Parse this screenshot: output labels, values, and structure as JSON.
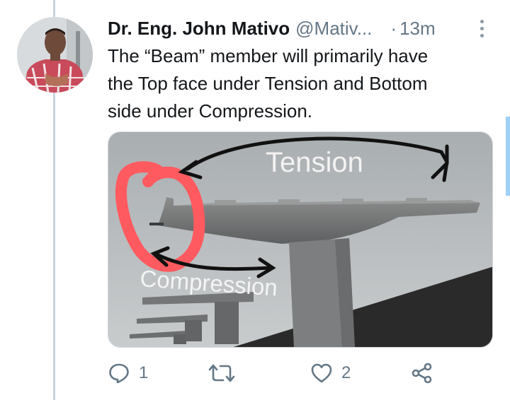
{
  "tweet": {
    "author_name": "Dr. Eng. John Mativo",
    "author_handle": "@Mativ...",
    "separator": "·",
    "timestamp": "13m",
    "text_lines": [
      "The “Beam” member will primarily have",
      "the Top face under Tension and Bottom",
      "side under Compression."
    ]
  },
  "media": {
    "label_tension": "Tension",
    "label_compression": "Compression",
    "annotation_color": "#ff5a5f",
    "arrow_color": "#111111"
  },
  "actions": {
    "reply_count": "1",
    "retweet_count": "",
    "like_count": "2"
  },
  "icons": {
    "reply": "reply-icon",
    "retweet": "retweet-icon",
    "like": "heart-icon",
    "share": "share-icon",
    "more": "more-vertical-icon"
  },
  "colors": {
    "text_primary": "#14171a",
    "text_secondary": "#657786",
    "thread_line": "#c9d3dc",
    "scroll_indicator": "#9fd0f5"
  }
}
